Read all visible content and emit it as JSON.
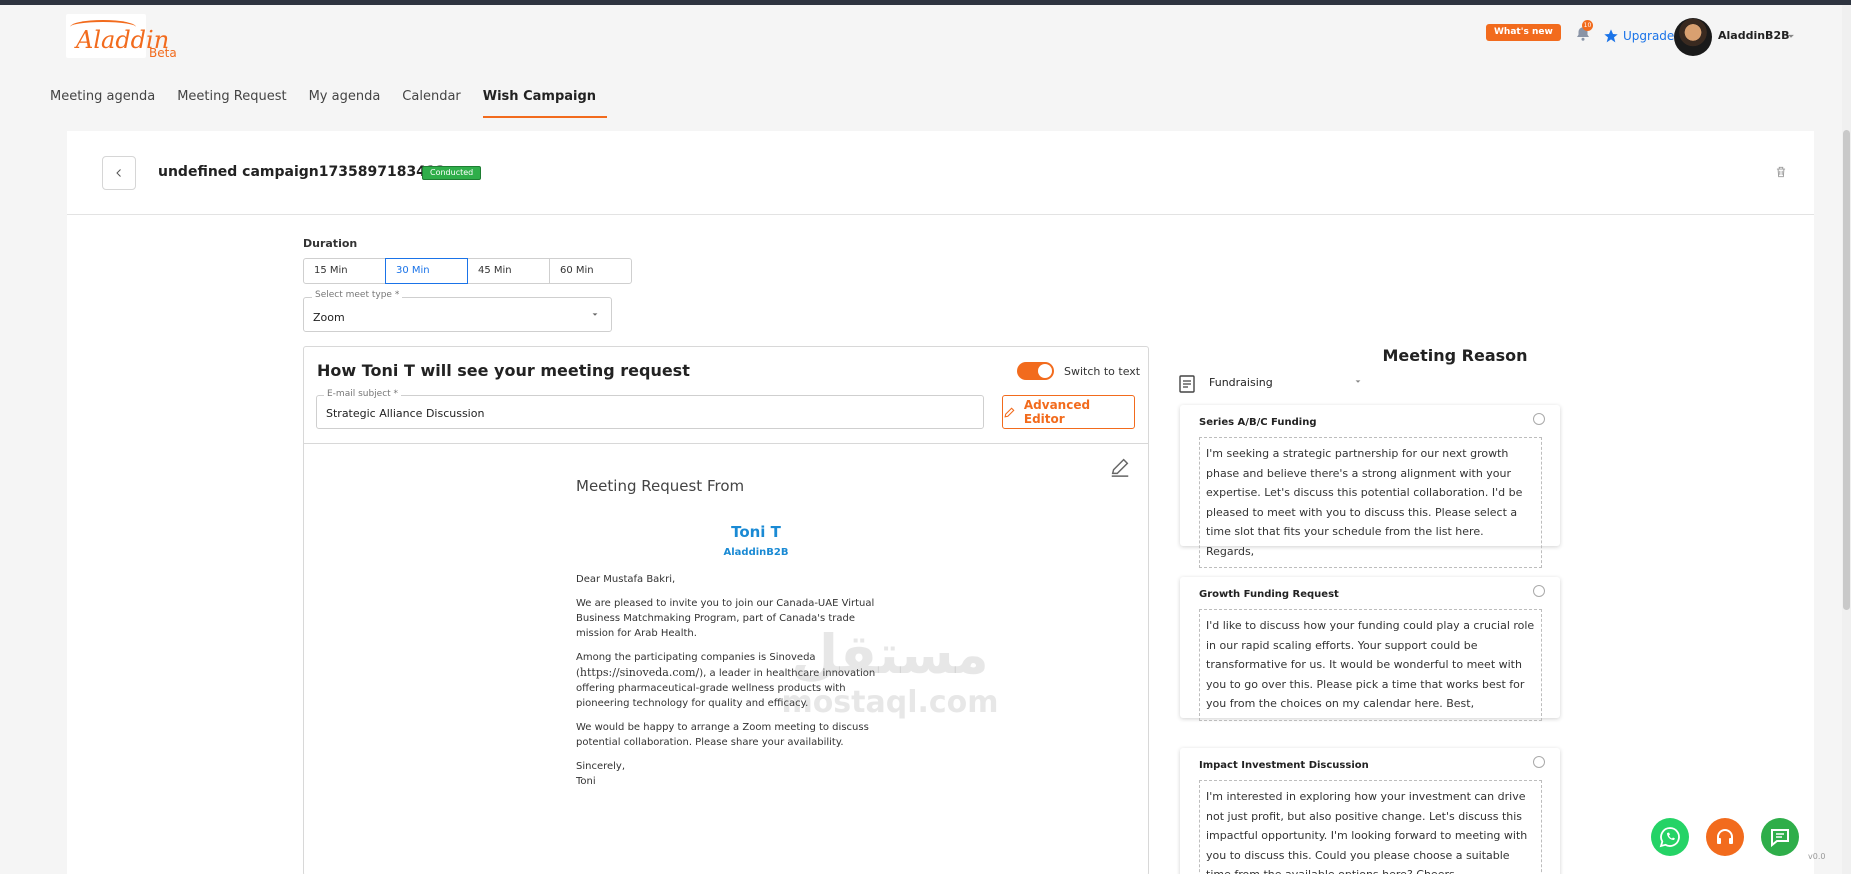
{
  "header": {
    "logo_text": "Aladdin",
    "logo_beta": "Beta",
    "whats_new": "What's new",
    "notif_count": "10",
    "upgrade_label": "Upgrade",
    "username": "AladdinB2B"
  },
  "nav": {
    "items": [
      "Meeting agenda",
      "Meeting Request",
      "My agenda",
      "Calendar",
      "Wish Campaign"
    ],
    "active": "Wish Campaign"
  },
  "campaign": {
    "title": "undefined campaign1735897183413",
    "status": "Conducted"
  },
  "duration": {
    "label": "Duration",
    "options": [
      "15 Min",
      "30 Min",
      "45 Min",
      "60 Min"
    ],
    "selected": "30 Min"
  },
  "meet_type": {
    "label": "Select meet type *",
    "value": "Zoom"
  },
  "preview": {
    "title": "How Toni T will see your meeting request",
    "switch_label": "Switch to text",
    "switch_on": true,
    "subject_label": "E-mail subject *",
    "subject_value": "Strategic Alliance Discussion",
    "advanced_editor": "Advanced Editor"
  },
  "mail": {
    "heading": "Meeting Request From",
    "name": "Toni T",
    "company": "AladdinB2B",
    "greeting": "Dear Mustafa Bakri,",
    "p1": "We are pleased to invite you to join our Canada-UAE Virtual Business Matchmaking Program, part of Canada's trade mission for Arab Health.",
    "p2_a": "Among the participating companies is Sinoveda (",
    "p2_url": "https://sinoveda.com/",
    "p2_b": "), a leader in healthcare innovation offering pharmaceutical-grade wellness products with pioneering technology for quality and efficacy.",
    "p3": "We would be happy to arrange a Zoom meeting to discuss potential collaboration. Please share your availability.",
    "signoff": "Sincerely,",
    "signature": "Toni"
  },
  "reason": {
    "title": "Meeting Reason",
    "category": "Fundraising",
    "cards": [
      {
        "title": "Series A/B/C Funding",
        "text": "I'm seeking a strategic partnership for our next growth phase and believe there's a strong alignment with your expertise. Let's discuss this potential collaboration. I'd be pleased to meet with you to discuss this. Please select a time slot that fits your schedule from the list here. Regards,"
      },
      {
        "title": "Growth Funding Request",
        "text": "I'd like to discuss how your funding could play a crucial role in our rapid scaling efforts. Your support could be transformative for us. It would be wonderful to meet with you to go over this. Please pick a time that works best for you from the choices on my calendar here. Best,"
      },
      {
        "title": "Impact Investment Discussion",
        "text": "I'm interested in exploring how your investment can drive not just profit, but also positive change. Let's discuss this impactful opportunity. I'm looking forward to meeting with you to discuss this. Could you please choose a suitable time from the available options here? Cheers,"
      }
    ]
  },
  "watermark": {
    "arabic": "مستقل",
    "latin": "mostaql.com"
  },
  "corner_text": "v0.0",
  "colors": {
    "accent": "#f26b1d",
    "link": "#1a73e8",
    "success": "#2fae4a"
  }
}
